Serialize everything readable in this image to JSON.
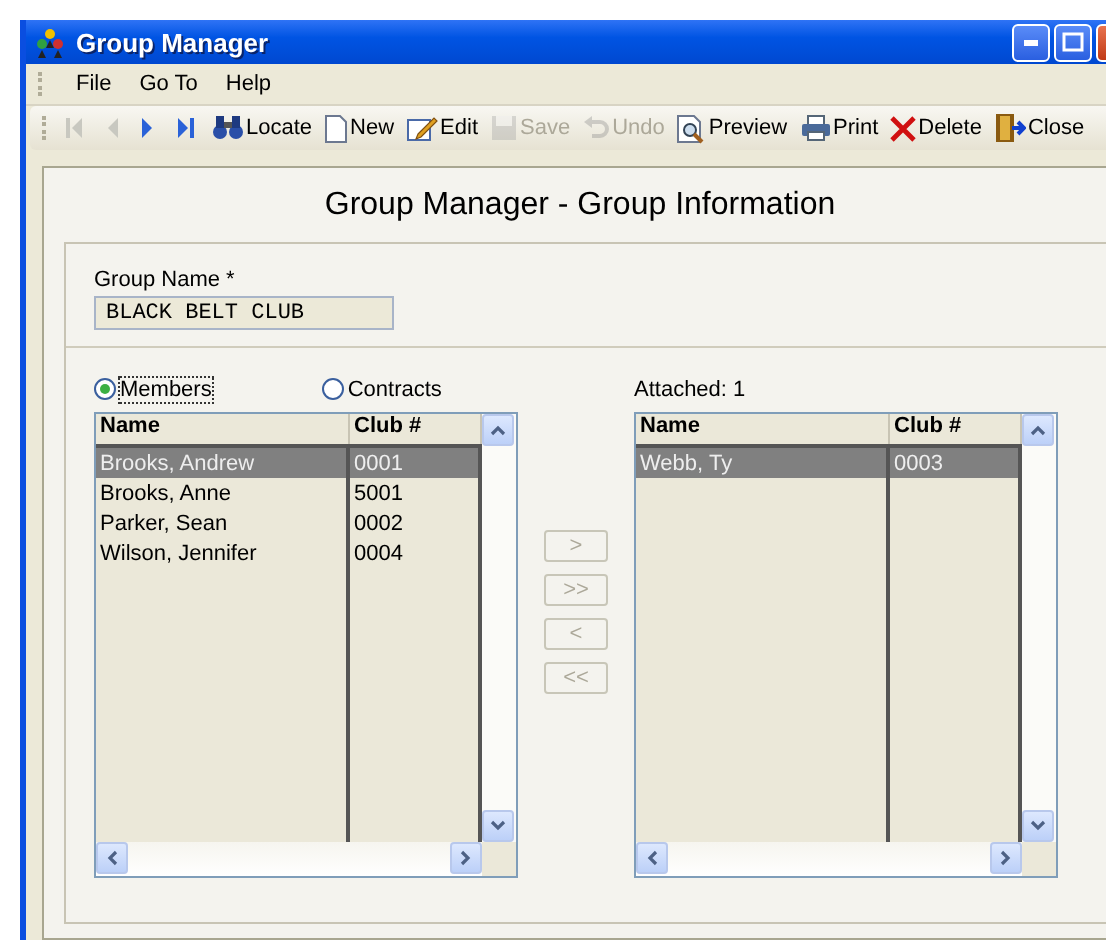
{
  "window": {
    "title": "Group Manager"
  },
  "menu": [
    {
      "label": "File"
    },
    {
      "label": "Go To"
    },
    {
      "label": "Help"
    }
  ],
  "toolbar": [
    {
      "kind": "first",
      "disabled": true
    },
    {
      "kind": "prev",
      "disabled": true
    },
    {
      "kind": "next",
      "disabled": false
    },
    {
      "kind": "last",
      "disabled": false
    },
    {
      "kind": "locate",
      "label": "Locate",
      "disabled": false
    },
    {
      "kind": "new",
      "label": "New",
      "disabled": false
    },
    {
      "kind": "edit",
      "label": "Edit",
      "disabled": false
    },
    {
      "kind": "save",
      "label": "Save",
      "disabled": true
    },
    {
      "kind": "undo",
      "label": "Undo",
      "disabled": true
    },
    {
      "kind": "preview",
      "label": "Preview",
      "disabled": false
    },
    {
      "kind": "print",
      "label": "Print",
      "disabled": false
    },
    {
      "kind": "delete",
      "label": "Delete",
      "disabled": false
    },
    {
      "kind": "close",
      "label": "Close",
      "disabled": false
    }
  ],
  "heading": "Group Manager - Group Information",
  "group_name": {
    "label": "Group Name *",
    "value": "BLACK BELT CLUB"
  },
  "source": {
    "options": [
      {
        "label": "Members",
        "selected": true
      },
      {
        "label": "Contracts",
        "selected": false
      }
    ],
    "columns": [
      "Name",
      "Club #"
    ],
    "rows": [
      {
        "name": "Brooks, Andrew",
        "club": "0001",
        "selected": true
      },
      {
        "name": "Brooks, Anne",
        "club": "5001",
        "selected": false
      },
      {
        "name": "Parker, Sean",
        "club": "0002",
        "selected": false
      },
      {
        "name": "Wilson, Jennifer",
        "club": "0004",
        "selected": false
      }
    ]
  },
  "move_buttons": [
    {
      "label": ">",
      "disabled": true
    },
    {
      "label": ">>",
      "disabled": true
    },
    {
      "label": "<",
      "disabled": true
    },
    {
      "label": "<<",
      "disabled": true
    }
  ],
  "attached": {
    "label": "Attached: 1",
    "columns": [
      "Name",
      "Club #"
    ],
    "rows": [
      {
        "name": "Webb, Ty",
        "club": "0003",
        "selected": true
      }
    ]
  }
}
